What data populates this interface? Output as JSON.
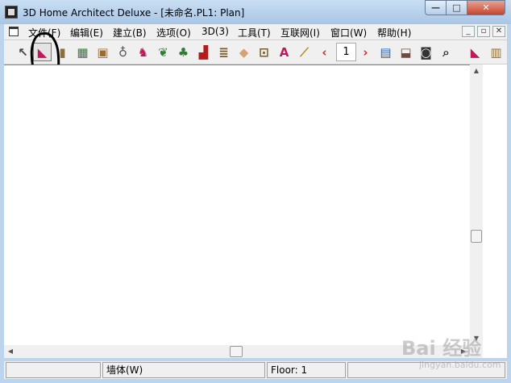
{
  "window": {
    "title": "3D Home Architect Deluxe - [未命名.PL1: Plan]",
    "controls": {
      "minimize": "—",
      "maximize": "□",
      "close": "✕"
    }
  },
  "menubar": {
    "items": [
      "文件(F)",
      "编辑(E)",
      "建立(B)",
      "选项(O)",
      "3D(3)",
      "工具(T)",
      "互联网(I)",
      "窗口(W)",
      "帮助(H)"
    ],
    "mdi_controls": [
      "_",
      "▫",
      "✕"
    ]
  },
  "toolbar": {
    "tools": [
      {
        "name": "select-arrow-icon",
        "glyph": "↖",
        "color": "#444444"
      },
      {
        "name": "wall-tool-icon",
        "glyph": "◣",
        "color": "#c2185b"
      },
      {
        "name": "door-icon",
        "glyph": "▮",
        "color": "#8d6e3a"
      },
      {
        "name": "window-icon",
        "glyph": "▦",
        "color": "#2e7d32"
      },
      {
        "name": "cabinet-icon",
        "glyph": "▣",
        "color": "#9c6b30"
      },
      {
        "name": "fixture-icon",
        "glyph": "♁",
        "color": "#555555"
      },
      {
        "name": "furniture-icon",
        "glyph": "♞",
        "color": "#c2185b"
      },
      {
        "name": "landscape-icon",
        "glyph": "❦",
        "color": "#2e7d32"
      },
      {
        "name": "tree-icon",
        "glyph": "♣",
        "color": "#2e7d32"
      },
      {
        "name": "fireplace-icon",
        "glyph": "▟",
        "color": "#b71c1c"
      },
      {
        "name": "stairs-icon",
        "glyph": "≣",
        "color": "#7b5b2a"
      },
      {
        "name": "roof-icon",
        "glyph": "◆",
        "color": "#d4a373"
      },
      {
        "name": "electrical-icon",
        "glyph": "⊡",
        "color": "#7b5b2a"
      },
      {
        "name": "text-icon",
        "glyph": "A",
        "color": "#c2185b"
      },
      {
        "name": "dimension-ruler-icon",
        "glyph": "⟋",
        "color": "#b8860b"
      },
      {
        "name": "floor-down-icon",
        "glyph": "‹",
        "color": "#c62828"
      },
      {
        "name": "floor-up-icon",
        "glyph": "›",
        "color": "#c62828"
      },
      {
        "name": "plan-view-icon",
        "glyph": "▤",
        "color": "#1565c0"
      },
      {
        "name": "elevation-view-icon",
        "glyph": "⬓",
        "color": "#6d4c41"
      },
      {
        "name": "camera-icon",
        "glyph": "◙",
        "color": "#333333"
      },
      {
        "name": "zoom-icon",
        "glyph": "⌕",
        "color": "#333333"
      }
    ],
    "floor_value": "1"
  },
  "side_toolbar": [
    {
      "name": "wall-tool-icon",
      "glyph": "◣",
      "color": "#c2185b"
    },
    {
      "name": "railing-icon",
      "glyph": "▥",
      "color": "#8d6e3a"
    }
  ],
  "scrollbar": {
    "up": "▲",
    "down": "▼",
    "left": "◀",
    "right": "▶"
  },
  "statusbar": {
    "cells": [
      "",
      "墙体(W)",
      "Floor: 1",
      ""
    ]
  },
  "watermark": {
    "text": "Bai 经验",
    "sub": "jingyan.baidu.com"
  }
}
